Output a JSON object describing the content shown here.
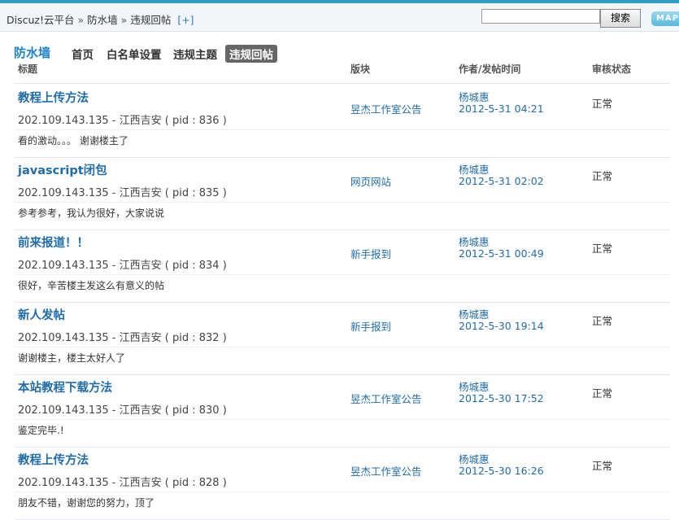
{
  "breadcrumb": {
    "items": [
      "Discuz!云平台",
      "防水墙",
      "违规回帖"
    ],
    "separator": "»",
    "add_label": "[+]"
  },
  "search": {
    "value": "",
    "button_label": "搜索"
  },
  "map_label": "MAP",
  "nav": {
    "title": "防水墙",
    "tabs": [
      {
        "label": "首页",
        "active": false
      },
      {
        "label": "白名单设置",
        "active": false
      },
      {
        "label": "违规主题",
        "active": false
      },
      {
        "label": "违规回帖",
        "active": true
      }
    ]
  },
  "table": {
    "headers": [
      "标题",
      "版块",
      "作者/发帖时间",
      "审核状态"
    ],
    "rows": [
      {
        "subject": "教程上传方法",
        "ip": "202.109.143.135",
        "location": "江西吉安",
        "pid_label": "pid",
        "pid": "836",
        "content": "看的激动。。。 谢谢楼主了",
        "forum": "昱杰工作室公告",
        "author": "杨城惠",
        "time": "2012-5-31 04:21",
        "status": "正常"
      },
      {
        "subject": "javascript闭包",
        "ip": "202.109.143.135",
        "location": "江西吉安",
        "pid_label": "pid",
        "pid": "835",
        "content": "参考参考，我认为很好，大家说说",
        "forum": "网页网站",
        "author": "杨城惠",
        "time": "2012-5-31 02:02",
        "status": "正常"
      },
      {
        "subject": "前来报道！！",
        "ip": "202.109.143.135",
        "location": "江西吉安",
        "pid_label": "pid",
        "pid": "834",
        "content": "很好，辛苦楼主发这么有意义的帖",
        "forum": "新手报到",
        "author": "杨城惠",
        "time": "2012-5-31 00:49",
        "status": "正常"
      },
      {
        "subject": "新人发帖",
        "ip": "202.109.143.135",
        "location": "江西吉安",
        "pid_label": "pid",
        "pid": "832",
        "content": "谢谢楼主，楼主太好人了",
        "forum": "新手报到",
        "author": "杨城惠",
        "time": "2012-5-30 19:14",
        "status": "正常"
      },
      {
        "subject": "本站教程下载方法",
        "ip": "202.109.143.135",
        "location": "江西吉安",
        "pid_label": "pid",
        "pid": "830",
        "content": "鉴定完毕.!",
        "forum": "昱杰工作室公告",
        "author": "杨城惠",
        "time": "2012-5-30 17:52",
        "status": "正常"
      },
      {
        "subject": "教程上传方法",
        "ip": "202.109.143.135",
        "location": "江西吉安",
        "pid_label": "pid",
        "pid": "828",
        "content": "朋友不错，谢谢您的努力，顶了",
        "forum": "昱杰工作室公告",
        "author": "杨城惠",
        "time": "2012-5-30 16:26",
        "status": "正常"
      }
    ]
  },
  "colors": {
    "accent": "#2f9ecb",
    "link": "#1f6ca8",
    "active_tab_bg": "#666666"
  }
}
